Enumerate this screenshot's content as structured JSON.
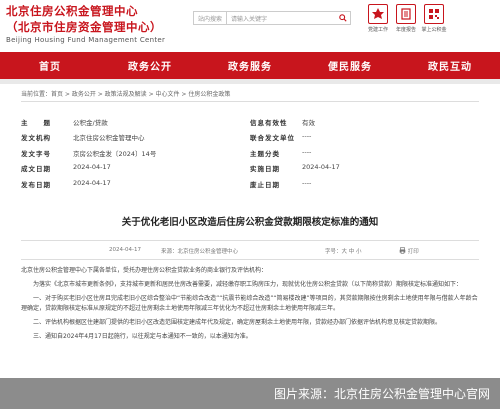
{
  "header": {
    "title_line1": "北京住房公积金管理中心",
    "title_line2": "（北京市住房资金管理中心）",
    "title_en": "Beijing Housing Fund Management Center",
    "search_scope": "站内搜索",
    "search_placeholder": "请输入关键字",
    "icons": [
      {
        "name": "party-icon",
        "label": "党建工作"
      },
      {
        "name": "report-icon",
        "label": "年度报告"
      },
      {
        "name": "app-icon",
        "label": "掌上公积金"
      }
    ]
  },
  "nav": [
    "首页",
    "政务公开",
    "政务服务",
    "便民服务",
    "政民互动"
  ],
  "breadcrumb": "当前位置：首页 > 政务公开 > 政策法规及解读 > 中心文件 > 住房公积金政策",
  "meta": [
    {
      "k": "主　　题",
      "v": "公积金/贷款",
      "k2": "信息有效性",
      "v2": "有效"
    },
    {
      "k": "发文机构",
      "v": "北京住房公积金管理中心",
      "k2": "联合发文单位",
      "v2": "----"
    },
    {
      "k": "发文字号",
      "v": "京房公积金发〔2024〕14号",
      "k2": "主题分类",
      "v2": "----"
    },
    {
      "k": "成文日期",
      "v": "2024-04-17",
      "k2": "实施日期",
      "v2": "2024-04-17"
    },
    {
      "k": "发布日期",
      "v": "2024-04-17",
      "k2": "废止日期",
      "v2": "----"
    }
  ],
  "article": {
    "title": "关于优化老旧小区改造后住房公积金贷款期限核定标准的通知",
    "date": "2024-04-17",
    "source": "来源：北京住房公积金管理中心",
    "font_size": "字号：大 中 小",
    "print": "打印",
    "paragraphs": [
      "北京住房公积金管理中心下属各单位，受托办理住房公积金贷款业务的商业银行及评估机构：",
      "为落实《北京市城市更新条例》，支持城市更新和居民住房改善需要，减轻缴存职工购房压力，现就优化住房公积金贷款（以下简称贷款）期限核定标准通知如下：",
      "一、对于购买老旧小区住房且完成老旧小区综合整治中“节能综合改造”“抗震节能综合改造”“简易楼改建”等项目的，其贷款期限按住房剩余土地使用年限与借款人年龄合理确定，贷款期限核定标准从原规定的不超过住房剩余土地使用年限减三年优化为不超过住房剩余土地使用年限减三年。",
      "二、评估机构根据区住建部门提供的老旧小区改造范围核定建成年代及规定，确定房屋剩余土地使用年限，贷款经办部门依据评估机构意见核定贷款期限。",
      "三、通知自2024年4月17日起施行，以往规定与本通知不一致的，以本通知为准。"
    ]
  },
  "watermark": "图片来源：北京住房公积金管理中心官网",
  "colors": {
    "brand_red": "#c8151d"
  }
}
